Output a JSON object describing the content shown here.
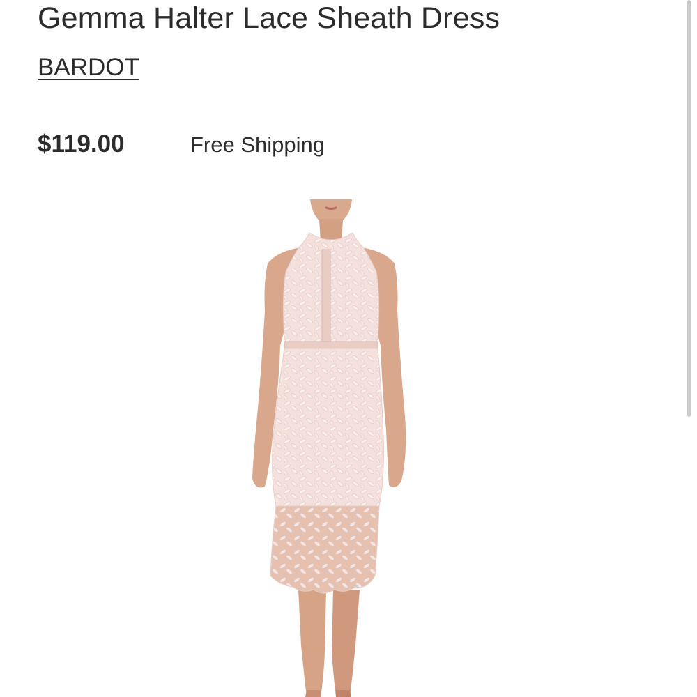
{
  "product": {
    "title": "Gemma Halter Lace Sheath Dress",
    "brand": "BARDOT",
    "price": "$119.00",
    "shipping": "Free Shipping"
  },
  "colors": {
    "text": "#2c2c2c",
    "dress": "#f4e1de",
    "skin": "#d9a98e",
    "scrollbar": "#c9c9c9"
  }
}
